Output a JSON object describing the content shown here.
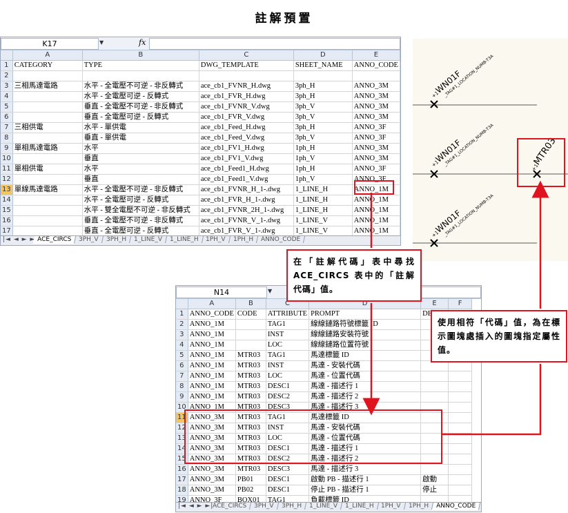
{
  "page_title": "註解預置",
  "sheet_top": {
    "name_box": "K17",
    "fx": "fx",
    "column_letters": [
      "A",
      "B",
      "C",
      "D",
      "E"
    ],
    "rows": [
      {
        "n": "1",
        "cells": [
          "CATEGORY",
          "TYPE",
          "DWG_TEMPLATE",
          "SHEET_NAME",
          "ANNO_CODE"
        ]
      },
      {
        "n": "2",
        "cells": [
          "",
          "",
          "",
          "",
          ""
        ]
      },
      {
        "n": "3",
        "cells": [
          "三相馬達電路",
          "水平 - 全電壓不可逆 - 非反轉式",
          "ace_cb1_FVNR_H.dwg",
          "3ph_H",
          "ANNO_3M"
        ]
      },
      {
        "n": "4",
        "cells": [
          "",
          "水平 - 全電壓可逆 - 反轉式",
          "ace_cb1_FVR_H.dwg",
          "3ph_H",
          "ANNO_3M"
        ]
      },
      {
        "n": "5",
        "cells": [
          "",
          "垂直 - 全電壓不可逆 - 非反轉式",
          "ace_cb1_FVNR_V.dwg",
          "3ph_V",
          "ANNO_3M"
        ]
      },
      {
        "n": "6",
        "cells": [
          "",
          "垂直 - 全電壓可逆 - 反轉式",
          "ace_cb1_FVR_V.dwg",
          "3ph_V",
          "ANNO_3M"
        ]
      },
      {
        "n": "7",
        "cells": [
          "三相供電",
          "水平 - 單供電",
          "ace_cb1_Feed_H.dwg",
          "3ph_H",
          "ANNO_3F"
        ]
      },
      {
        "n": "8",
        "cells": [
          "",
          "垂直 - 單供電",
          "ace_cb1_Feed_V.dwg",
          "3ph_V",
          "ANNO_3F"
        ]
      },
      {
        "n": "9",
        "cells": [
          "單相馬達電路",
          "水平",
          "ace_cb1_FV1_H.dwg",
          "1ph_H",
          "ANNO_3M"
        ]
      },
      {
        "n": "10",
        "cells": [
          "",
          "垂直",
          "ace_cb1_FV1_V.dwg",
          "1ph_V",
          "ANNO_3M"
        ]
      },
      {
        "n": "11",
        "cells": [
          "單相供電",
          "水平",
          "ace_cb1_Feed1_H.dwg",
          "1ph_H",
          "ANNO_3F"
        ]
      },
      {
        "n": "12",
        "cells": [
          "",
          "垂直",
          "ace_cb1_Feed1_V.dwg",
          "1ph_V",
          "ANNO_3F"
        ]
      },
      {
        "n": "13",
        "cells": [
          "單線馬達電路",
          "水平 - 全電壓不可逆 - 非反轉式",
          "ace_cb1_FVNR_H_1-.dwg",
          "1_LINE_H",
          "ANNO_1M"
        ]
      },
      {
        "n": "14",
        "cells": [
          "",
          "水平 - 全電壓可逆 - 反轉式",
          "ace_cb1_FVR_H_1-.dwg",
          "1_LINE_H",
          "ANNO_1M"
        ]
      },
      {
        "n": "15",
        "cells": [
          "",
          "水平 - 雙全電壓不可逆 - 非反轉式",
          "ace_cb1_FVNR_2H_1-.dwg",
          "1_LINE_H",
          "ANNO_1M"
        ]
      },
      {
        "n": "16",
        "cells": [
          "",
          "垂直 - 全電壓不可逆 - 非反轉式",
          "ace_cb1_FVNR_V_1-.dwg",
          "1_LINE_V",
          "ANNO_1M"
        ]
      },
      {
        "n": "17",
        "cells": [
          "",
          "垂直 - 全電壓可逆 - 反轉式",
          "ace_cb1_FVR_V_1-.dwg",
          "1_LINE_V",
          "ANNO_1M"
        ]
      }
    ],
    "selected_row": "13",
    "tabs": [
      "ACE_CIRCS",
      "3PH_V",
      "3PH_H",
      "1_LINE_V",
      "1_LINE_H",
      "1PH_V",
      "1PH_H",
      "ANNO_CODE"
    ],
    "active_tab": "ACE_CIRCS"
  },
  "sheet_bottom": {
    "name_box": "N14",
    "fx": "fx",
    "column_letters": [
      "A",
      "B",
      "C",
      "D",
      "E",
      "F"
    ],
    "rows": [
      {
        "n": "1",
        "cells": [
          "ANNO_CODE",
          "CODE",
          "ATTRIBUTE",
          "PROMPT",
          "DE",
          ""
        ]
      },
      {
        "n": "2",
        "cells": [
          "ANNO_1M",
          "",
          "TAG1",
          "線線鏈路符號標籤 ID",
          "",
          ""
        ]
      },
      {
        "n": "3",
        "cells": [
          "ANNO_1M",
          "",
          "INST",
          "線線鏈路安裝符號",
          "",
          ""
        ]
      },
      {
        "n": "4",
        "cells": [
          "ANNO_1M",
          "",
          "LOC",
          "線線鏈路位置符號",
          "",
          ""
        ]
      },
      {
        "n": "5",
        "cells": [
          "ANNO_1M",
          "MTR03",
          "TAG1",
          "馬達標籤 ID",
          "",
          ""
        ]
      },
      {
        "n": "6",
        "cells": [
          "ANNO_1M",
          "MTR03",
          "INST",
          "馬達 - 安裝代碼",
          "",
          ""
        ]
      },
      {
        "n": "7",
        "cells": [
          "ANNO_1M",
          "MTR03",
          "LOC",
          "馬達 - 位置代碼",
          "",
          ""
        ]
      },
      {
        "n": "8",
        "cells": [
          "ANNO_1M",
          "MTR03",
          "DESC1",
          "馬達 - 描述行 1",
          "",
          ""
        ]
      },
      {
        "n": "9",
        "cells": [
          "ANNO_1M",
          "MTR03",
          "DESC2",
          "馬達 - 描述行 2",
          "",
          ""
        ]
      },
      {
        "n": "10",
        "cells": [
          "ANNO_1M",
          "MTR03",
          "DESC3",
          "馬達 - 描述行 3",
          "",
          ""
        ]
      },
      {
        "n": "11",
        "cells": [
          "ANNO_3M",
          "MTR03",
          "TAG1",
          "馬達標籤 ID",
          "",
          ""
        ]
      },
      {
        "n": "12",
        "cells": [
          "ANNO_3M",
          "MTR03",
          "INST",
          "馬達 - 安裝代碼",
          "",
          ""
        ]
      },
      {
        "n": "13",
        "cells": [
          "ANNO_3M",
          "MTR03",
          "LOC",
          "馬達 - 位置代碼",
          "",
          ""
        ]
      },
      {
        "n": "14",
        "cells": [
          "ANNO_3M",
          "MTR03",
          "DESC1",
          "馬達 - 描述行 1",
          "",
          ""
        ]
      },
      {
        "n": "15",
        "cells": [
          "ANNO_3M",
          "MTR03",
          "DESC2",
          "馬達 - 描述行 2",
          "",
          ""
        ]
      },
      {
        "n": "16",
        "cells": [
          "ANNO_3M",
          "MTR03",
          "DESC3",
          "馬達 - 描述行 3",
          "",
          ""
        ]
      },
      {
        "n": "17",
        "cells": [
          "ANNO_3M",
          "PB01",
          "DESC1",
          "啟動 PB - 描述行 1",
          "啟動",
          ""
        ]
      },
      {
        "n": "18",
        "cells": [
          "ANNO_3M",
          "PB02",
          "DESC1",
          "停止 PB - 描述行 1",
          "停止",
          ""
        ]
      },
      {
        "n": "19",
        "cells": [
          "ANNO_3F",
          "BOX01",
          "TAG1",
          "負載標籤 ID",
          "",
          ""
        ]
      }
    ],
    "selected_row": "11",
    "tabs": [
      "ACE_CIRCS",
      "3PH_V",
      "3PH_H",
      "1_LINE_V",
      "1_LINE_H",
      "1PH_V",
      "1PH_H",
      "ANNO_CODE"
    ],
    "active_tab": "ANNO_CODE"
  },
  "drawing": {
    "labels": [
      {
        "big": "WN01F",
        "small": "_TAG#1_LOCATION_NUMB-T3A",
        "prefix": "+1"
      },
      {
        "big": "WN01F",
        "small": "_TAG#1_LOCATION_NUMB-T3A",
        "prefix": "+1"
      },
      {
        "big": "WN01F",
        "small": "_TAG#1_LOCATION_NUMB-T3A",
        "prefix": "+1"
      }
    ],
    "motor_tag": "MTR03",
    "motor_prefix": "+1"
  },
  "callouts": {
    "middle": "在「註解代碼」表中尋找 ACE_CIRCS 表中的「註解代碼」值。",
    "right": "使用相符「代碼」值，為在標示圖塊處插入的圖塊指定屬性值。"
  },
  "colors": {
    "accent_red": "#e0141e",
    "header_bg": "#e4ebf5",
    "selected_row_header": "#f6c65c",
    "drawing_bg": "#fbf9ef"
  }
}
